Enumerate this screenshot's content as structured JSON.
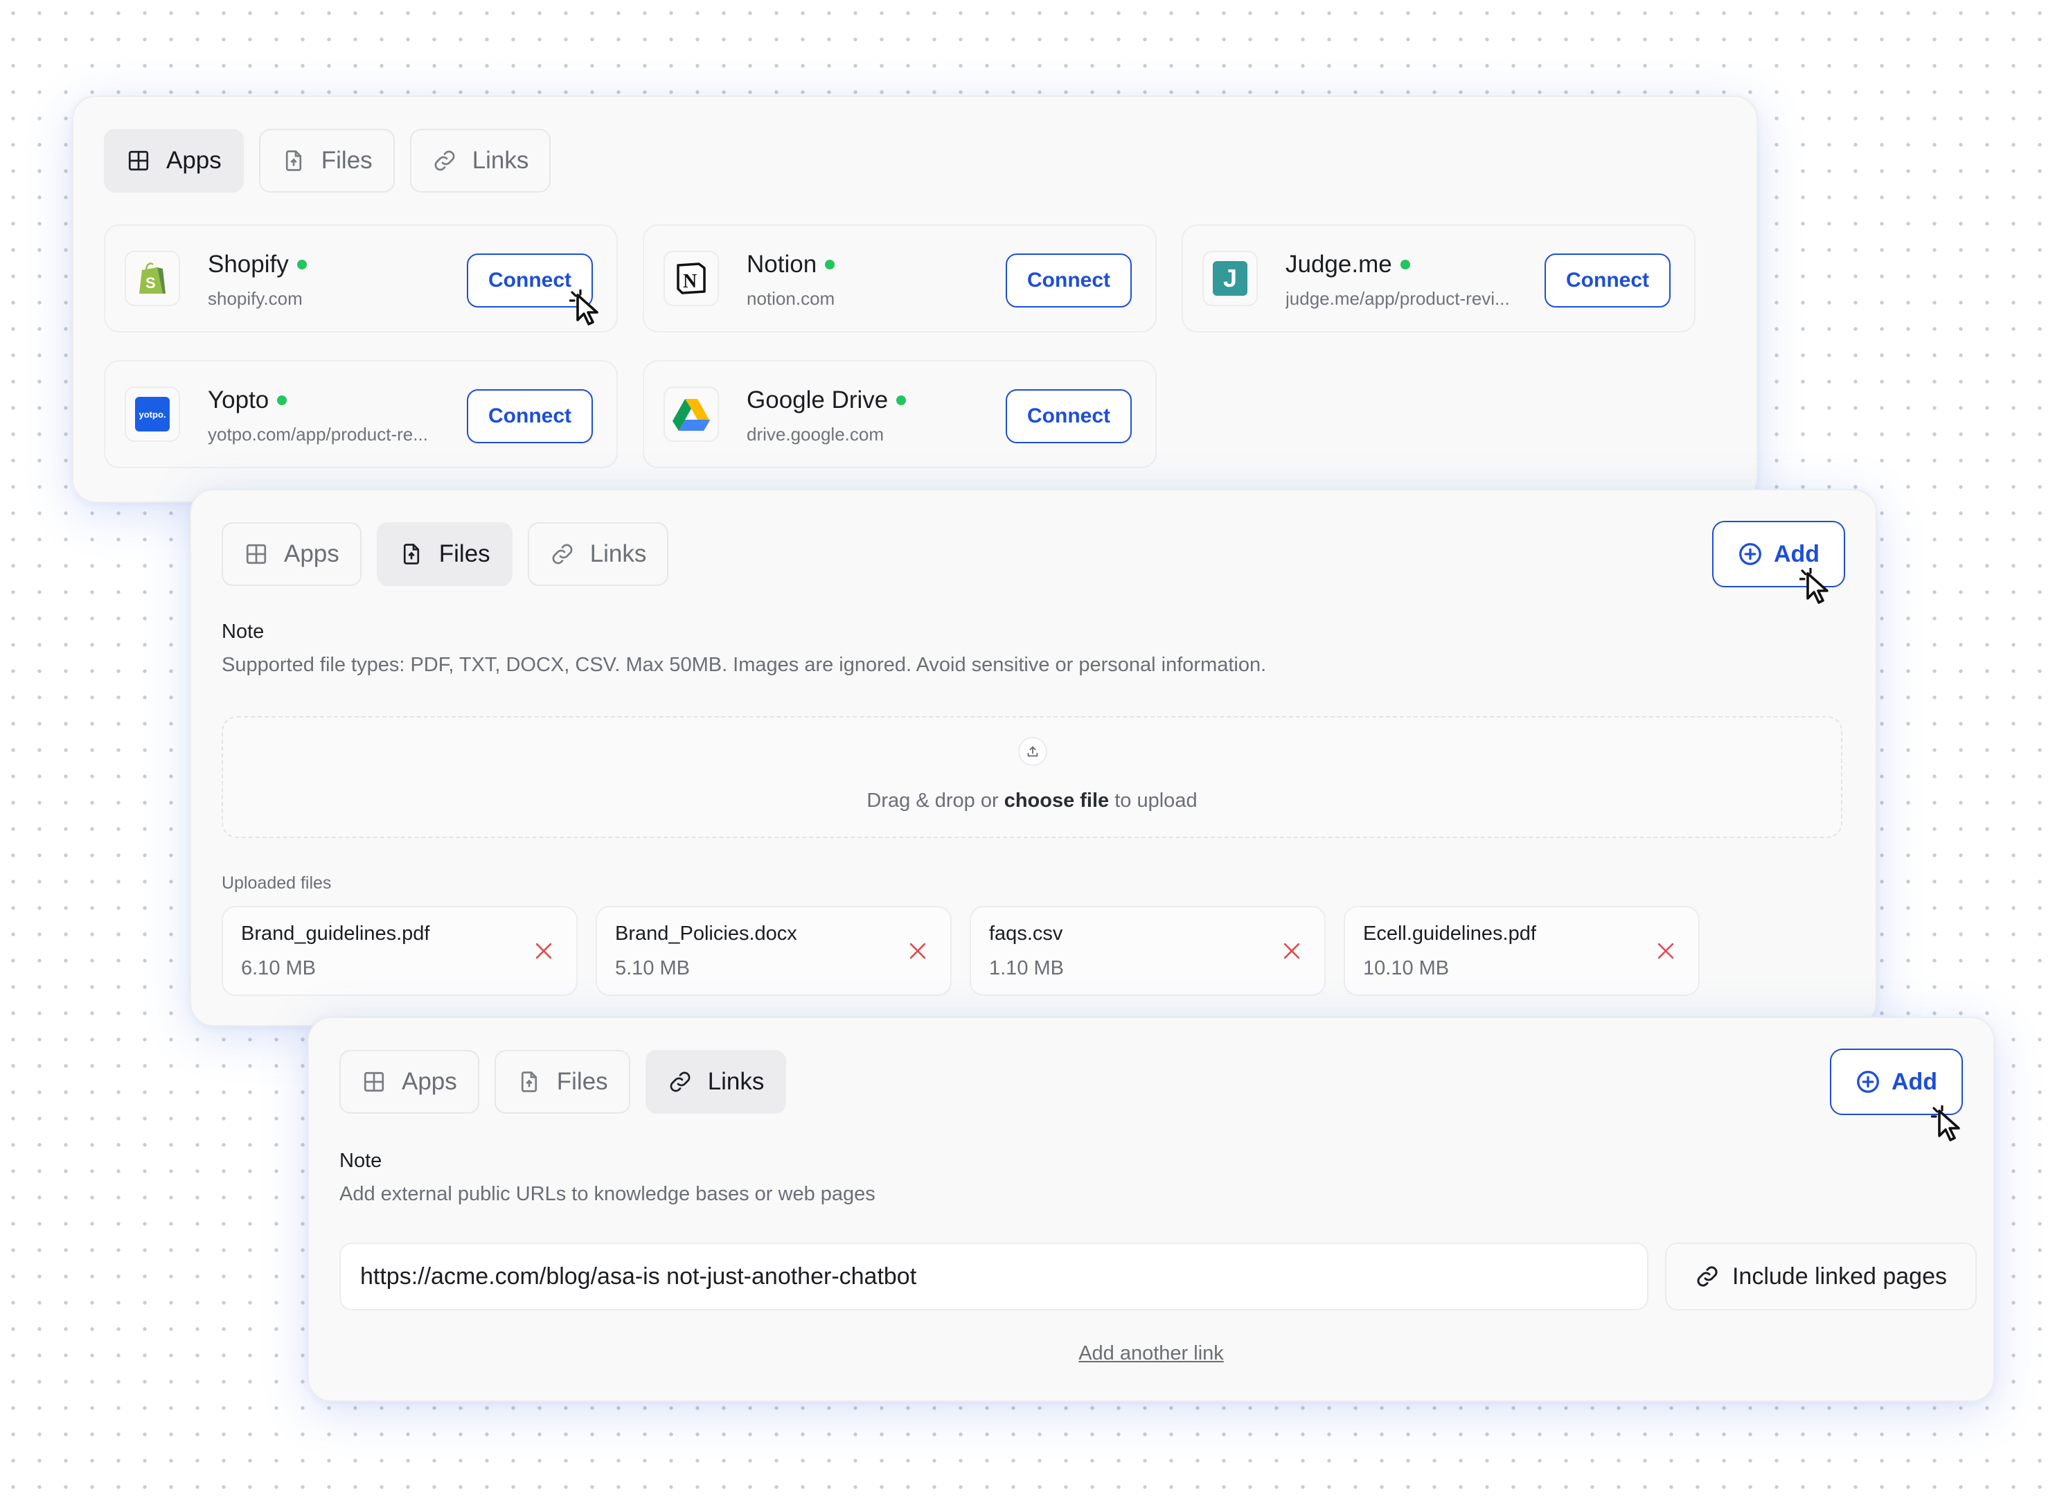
{
  "tabs": {
    "apps": "Apps",
    "files": "Files",
    "links": "Links"
  },
  "apps": [
    {
      "name": "Shopify",
      "url": "shopify.com",
      "connect": "Connect",
      "icon": "shopify-logo"
    },
    {
      "name": "Notion",
      "url": "notion.com",
      "connect": "Connect",
      "icon": "notion-logo"
    },
    {
      "name": "Judge.me",
      "url": "judge.me/app/product-revi...",
      "connect": "Connect",
      "icon": "judgeme-logo",
      "logo_text": "J"
    },
    {
      "name": "Yopto",
      "url": "yotpo.com/app/product-re...",
      "connect": "Connect",
      "icon": "yotpo-logo",
      "logo_text": "yotpo."
    },
    {
      "name": "Google Drive",
      "url": "drive.google.com",
      "connect": "Connect",
      "icon": "google-drive-logo"
    }
  ],
  "files_panel": {
    "add_label": "Add",
    "note_title": "Note",
    "note_text": "Supported file types: PDF, TXT, DOCX, CSV. Max 50MB. Images are ignored. Avoid sensitive or personal information.",
    "drop_text_pre": "Drag & drop or ",
    "drop_text_link": "choose file",
    "drop_text_post": " to upload",
    "uploaded_label": "Uploaded files",
    "files": [
      {
        "name": "Brand_guidelines.pdf",
        "size": "6.10 MB"
      },
      {
        "name": "Brand_Policies.docx",
        "size": "5.10 MB"
      },
      {
        "name": "faqs.csv",
        "size": "1.10 MB"
      },
      {
        "name": "Ecell.guidelines.pdf",
        "size": "10.10 MB"
      }
    ]
  },
  "links_panel": {
    "add_label": "Add",
    "note_title": "Note",
    "note_text": "Add external public URLs to knowledge bases or web pages",
    "url_value": "https://acme.com/blog/asa-is not-just-another-chatbot",
    "include_label": "Include linked pages",
    "add_another": "Add another link"
  },
  "colors": {
    "accent": "#1d4ed8",
    "status_dot": "#22c55e",
    "remove_x": "#e5484d"
  }
}
